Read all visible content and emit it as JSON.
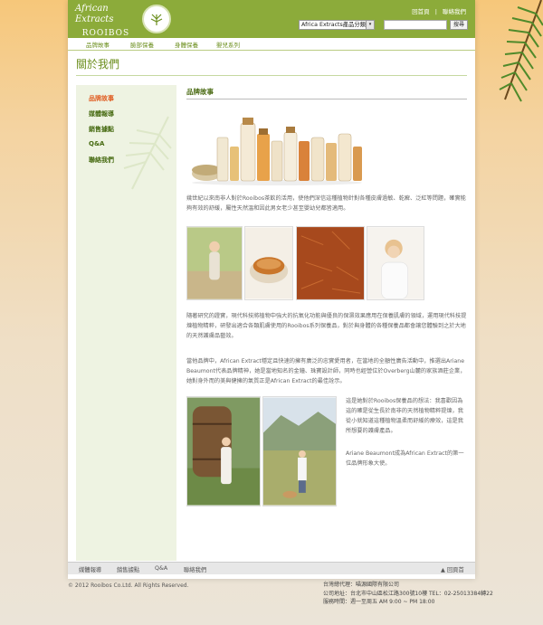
{
  "brand": {
    "name_line1": "African Extracts",
    "name_line2": "ROOIBOS"
  },
  "toplinks": [
    "回首頁",
    "|",
    "聯絡我們"
  ],
  "search": {
    "select_value": "Africa Extracts產品分類",
    "arrow": "▾",
    "button": "搜尋"
  },
  "nav": [
    "品牌故事",
    "臉部保養",
    "身體保養",
    "嬰兒系列"
  ],
  "page_title": "關於我們",
  "sidebar": [
    "品牌故事",
    "媒體報導",
    "銷售據點",
    "Q&A",
    "聯絡我們"
  ],
  "content": {
    "title": "品牌故事",
    "p1": "幾世紀以來南非人對於Rooibos茶飲的活用，使他們深信這種植物針對各種皮膚過敏、乾癬、泛紅等問題，確實能夠有效的舒緩，屬性天然溫和因此男女老少甚至嬰幼兒都皆適用。",
    "p2": "隨著研究的證實，現代科技將植物中強大的抗氧化功能與優良的保濕效果應用在保養肌膚的領域，運用現代科技提煉植物精粹，研發出適合各類肌膚使用的Rooibos系列保養品，對於與身體的各種保養品都會讓您體驗到之於大地的天然護膚品藝效。",
    "p3": "當他品牌中，African Extract穩定且快速的擁有廣泛的忠實愛用者，在當地的全額性廣告活動中，推選出Ariane Beaumont代表品牌精神，她是當地知名的金鐘、珠寶設計師，同時也經營位於Overberg山麓的家族酒莊企業，她對身外而的美與健擁的氣質正是African Extract的最佳詮示。",
    "p4": "這是她對於Rooibos保養品的想法：我喜歡因為這的確是從生長於南非的天然植物精粹提煉，我從小就知道這種植物溫柔而舒緩的療效，這是我所想要的護膚產品。",
    "p5": "Ariane Beaumont成為African Extract的第一位品牌形象大使。"
  },
  "footer": {
    "links": [
      "媒體報導",
      "銷售據點",
      "Q&A",
      "聯絡我們"
    ],
    "top": "▲ 回頁首"
  },
  "copyright": "© 2012  Rooibos Co.Ltd. All Rights Reserved.",
  "info": [
    "台灣總代理：喵源國際有限公司",
    "公司地址：台北市中山區松江路300號10樓    TEL：02-25013384轉22",
    "服務時間：週一至周五 AM 9:00 ~ PM 18:00"
  ],
  "colors": {
    "header": "#8cab3a",
    "accent": "#e05a1e",
    "nav_text": "#6c8f1e"
  }
}
